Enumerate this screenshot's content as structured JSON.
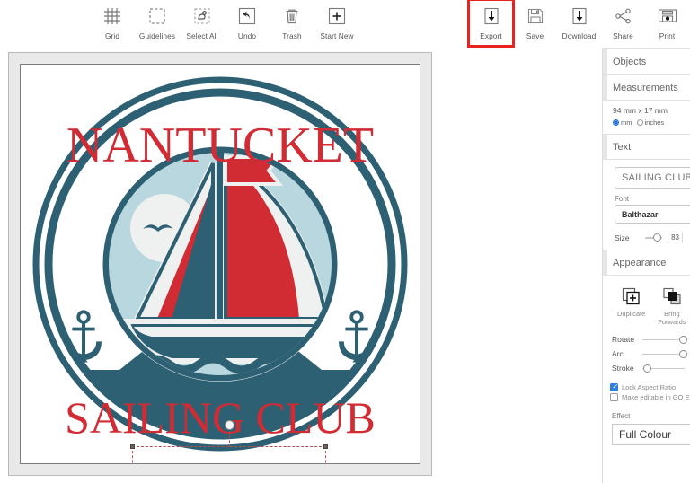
{
  "toolbar": {
    "left_tools": [
      {
        "label": "Grid",
        "icon": "grid-icon"
      },
      {
        "label": "Guidelines",
        "icon": "guidelines-icon"
      },
      {
        "label": "Select All",
        "icon": "select-all-icon"
      },
      {
        "label": "Undo",
        "icon": "undo-icon"
      },
      {
        "label": "Trash",
        "icon": "trash-icon"
      },
      {
        "label": "Start New",
        "icon": "plus-icon"
      }
    ],
    "right_tools": [
      {
        "label": "Export",
        "icon": "export-down-arrow-icon",
        "highlighted": true
      },
      {
        "label": "Save",
        "icon": "floppy-disk-icon",
        "highlighted": false
      },
      {
        "label": "Download",
        "icon": "download-arrow-icon",
        "highlighted": false
      },
      {
        "label": "Share",
        "icon": "share-nodes-icon",
        "highlighted": false
      },
      {
        "label": "Print",
        "icon": "printer-icon",
        "highlighted": false
      }
    ],
    "highlight_color": "#e8221f"
  },
  "canvas": {
    "logo": {
      "top_text": "NANTUCKET",
      "bottom_text": "SAILING CLUB",
      "colors": {
        "teal": "#2E6073",
        "red": "#D12B33",
        "light_blue": "#B9D7DE",
        "off_white": "#EFF0F0"
      }
    },
    "selection": {
      "selected_object": "SAILING CLUB",
      "handle_count": 4,
      "rotate_handle": true
    }
  },
  "panel": {
    "sections": {
      "objects": {
        "title": "Objects"
      },
      "measurements": {
        "title": "Measurements",
        "dimensions": "94 mm x 17 mm",
        "units": [
          {
            "label": "mm",
            "selected": true
          },
          {
            "label": "inches",
            "selected": false
          }
        ]
      },
      "text": {
        "title": "Text",
        "value": "SAILING CLUB",
        "placeholder": "SAILING CLUB",
        "font_label": "Font",
        "font_value": "Balthazar",
        "size_label": "Size",
        "size_value": "83"
      },
      "appearance": {
        "title": "Appearance",
        "actions": [
          {
            "label": "Duplicate",
            "icon": "duplicate-icon"
          },
          {
            "label": "Bring Forwards",
            "icon": "bring-forwards-icon"
          }
        ],
        "sliders": [
          {
            "label": "Rotate",
            "position_pct": 88
          },
          {
            "label": "Arc",
            "position_pct": 88
          },
          {
            "label": "Stroke",
            "position_pct": 6
          }
        ],
        "checkboxes": [
          {
            "label": "Lock Aspect Ratio",
            "checked": true
          },
          {
            "label": "Make editable in GO Ex",
            "checked": false
          }
        ],
        "effect_label": "Effect",
        "effect_value": "Full Colour"
      }
    }
  }
}
